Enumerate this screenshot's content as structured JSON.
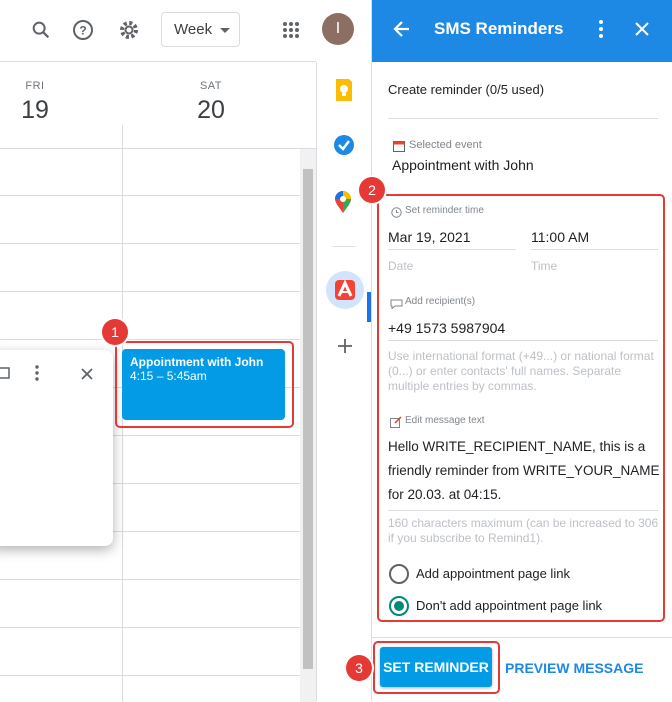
{
  "topbar": {
    "view_select": "Week",
    "avatar_letter": "I"
  },
  "calendar": {
    "days": [
      {
        "dow": "FRI",
        "date": "19"
      },
      {
        "dow": "SAT",
        "date": "20"
      }
    ],
    "event": {
      "title": "Appointment with John",
      "time": "4:15 – 5:45am"
    }
  },
  "annotations": {
    "badge1": "1",
    "badge2": "2",
    "badge3": "3"
  },
  "panel": {
    "title": "SMS Reminders",
    "create_label": "Create reminder (0/5 used)",
    "selected_event_label": "Selected event",
    "selected_event_value": "Appointment with John",
    "reminder_time_label": "Set reminder time",
    "date_value": "Mar 19, 2021",
    "date_label": "Date",
    "time_value": "11:00 AM",
    "time_label": "Time",
    "recipients_label": "Add recipient(s)",
    "recipients_value": "+49 1573 5987904",
    "recipients_hint": "Use international format (+49...) or national format (0...) or enter contacts' full names. Separate multiple entries by commas.",
    "message_label": "Edit message text",
    "message_value": "Hello WRITE_RECIPIENT_NAME, this is a friendly reminder from WRITE_YOUR_NAME for 20.03. at 04:15.",
    "message_hint": "160 characters maximum (can be increased to 306 if you subscribe to Remind1).",
    "radio_add_label": "Add appointment page link",
    "radio_dont_label": "Don't add appointment page link",
    "set_button": "SET REMINDER",
    "preview_button": "PREVIEW MESSAGE"
  }
}
